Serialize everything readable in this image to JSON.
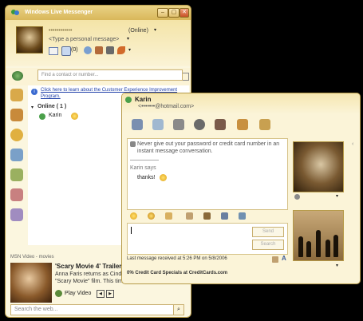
{
  "main": {
    "title": "Windows Live Messenger",
    "user": {
      "name": "••••••••••••",
      "status": "(Online)",
      "personal_message": "<Type a personal message>"
    },
    "inbox_count": "(0)",
    "search_placeholder": "Find a contact or number...",
    "notice": "Click here to learn about the Customer Experience Improvement Program.",
    "group": {
      "label": "Online ( 1 )",
      "contact": "Karin"
    },
    "ad": {
      "header": "MSN Video - movies",
      "title": "'Scary Movie 4' Trailer",
      "line1": "Anna Faris returns as Cind",
      "line2": "\"Scary Movie\" film. This tim",
      "play_label": "Play Video"
    },
    "web_search_placeholder": "Search the web..."
  },
  "conversation": {
    "contact_name": "Karin",
    "contact_email": "<•••••••@hotmail.com>",
    "warning": "Never give out your password or credit card number in an instant message conversation.",
    "sender": "Karin says",
    "message": "thanks!",
    "send_label": "Send",
    "search_label": "Search",
    "status": "Last message received at 5:26 PM on 5/8/2006",
    "ad_text": "0% Credit Card Specials at CreditCards.com"
  },
  "colors": {
    "chrome": "#fbf6df",
    "accent_gold": "#d9b75a",
    "link": "#1f3fa8"
  }
}
